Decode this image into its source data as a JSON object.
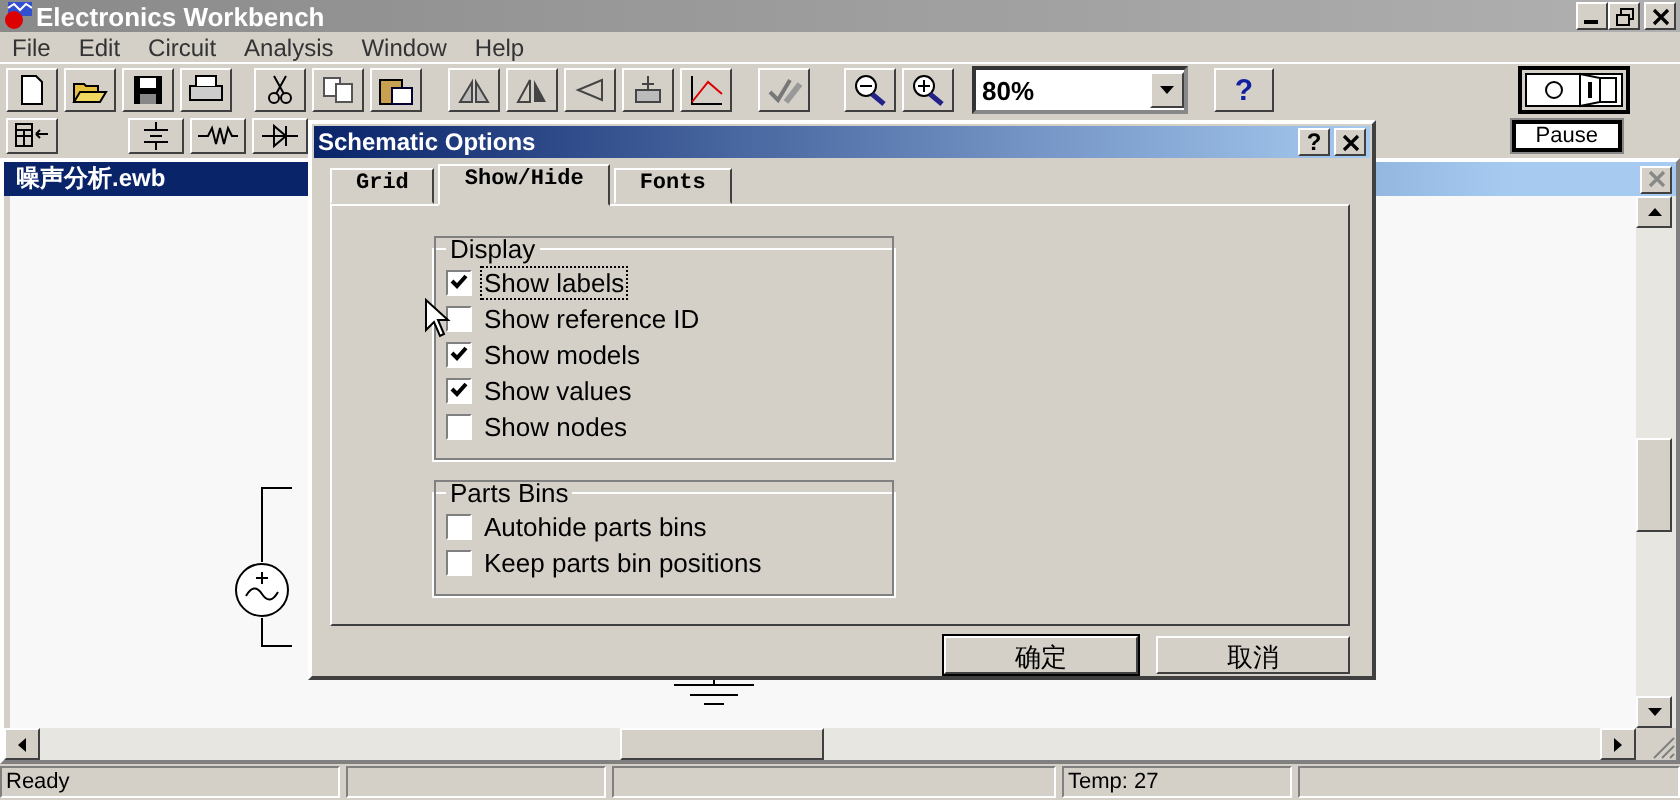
{
  "app": {
    "title": "Electronics Workbench"
  },
  "menu": [
    {
      "label": "File"
    },
    {
      "label": "Edit"
    },
    {
      "label": "Circuit"
    },
    {
      "label": "Analysis"
    },
    {
      "label": "Window"
    },
    {
      "label": "Help"
    }
  ],
  "toolbar": {
    "power": {
      "on": false
    },
    "zoom": {
      "value": "80%"
    },
    "help_button": "?",
    "pause_button": "Pause"
  },
  "document": {
    "title": "噪声分析.ewb"
  },
  "dialog": {
    "title": "Schematic Options",
    "help_button": "?",
    "tabs": [
      {
        "label": "Grid",
        "selected": false
      },
      {
        "label": "Show/Hide",
        "selected": true
      },
      {
        "label": "Fonts",
        "selected": false
      }
    ],
    "groups": [
      {
        "title": "Display",
        "options": [
          {
            "label": "Show labels",
            "checked": true,
            "focused": true
          },
          {
            "label": "Show reference ID",
            "checked": false,
            "focused": false
          },
          {
            "label": "Show models",
            "checked": true,
            "focused": false
          },
          {
            "label": "Show values",
            "checked": true,
            "focused": false
          },
          {
            "label": "Show nodes",
            "checked": false,
            "focused": false
          }
        ]
      },
      {
        "title": "Parts Bins",
        "options": [
          {
            "label": "Autohide parts bins",
            "checked": false,
            "focused": false
          },
          {
            "label": "Keep parts bin positions",
            "checked": false,
            "focused": false
          }
        ]
      }
    ],
    "buttons": [
      {
        "label": "确定",
        "default": true
      },
      {
        "label": "取消",
        "default": false
      }
    ]
  },
  "status_bar": {
    "message": "Ready",
    "temperature": "Temp: 27"
  }
}
